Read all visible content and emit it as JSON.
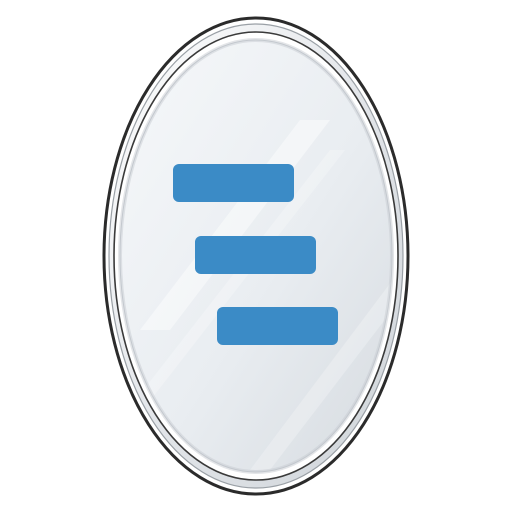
{
  "icon": {
    "name": "oval-mirror-app-icon",
    "glyph": "staggered-bars-icon",
    "colors": {
      "background": "#ffffff",
      "frame_outer": "#2b2b2b",
      "frame_ring": "#d9dde2",
      "frame_highlight": "#ffffff",
      "glass_light": "#f4f6f8",
      "glass_dark": "#d8dde2",
      "bar_fill": "#3b8bc6"
    },
    "bars": [
      {
        "name": "top-bar"
      },
      {
        "name": "middle-bar"
      },
      {
        "name": "bottom-bar"
      }
    ]
  }
}
